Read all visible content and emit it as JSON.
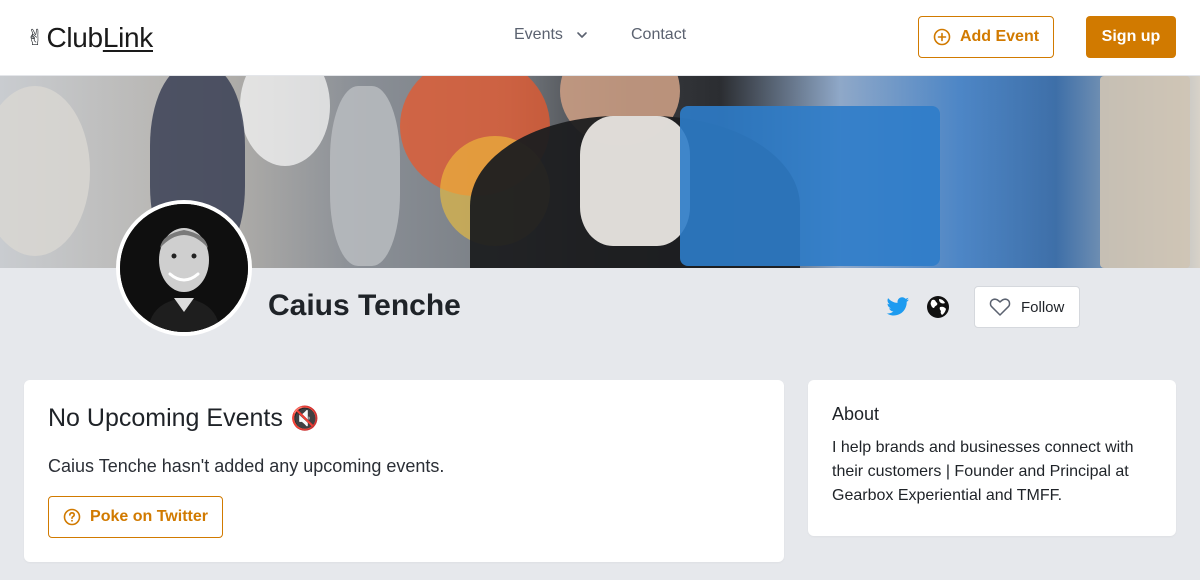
{
  "header": {
    "logo_club": "Club",
    "logo_link": "Link",
    "logo_hand": "✌",
    "nav": {
      "events": "Events",
      "contact": "Contact"
    },
    "add_event": "Add Event",
    "sign_up": "Sign up"
  },
  "profile": {
    "name": "Caius Tenche"
  },
  "events_card": {
    "title": "No Upcoming Events",
    "title_emoji": "🔇",
    "description": "Caius Tenche hasn't added any upcoming events.",
    "poke_label": "Poke on Twitter"
  },
  "about_card": {
    "title": "About",
    "text": "I help brands and businesses connect with their customers | Founder and Principal at Gearbox Experiential and TMFF."
  },
  "follow_label": "Follow",
  "colors": {
    "accent": "#d17a00",
    "twitter": "#1d9bf0",
    "background": "#e6e8ec"
  },
  "icons": {
    "add": "plus-circle-icon",
    "chevron": "chevron-down-icon",
    "twitter": "twitter-icon",
    "globe": "globe-icon",
    "follow": "heart-icon",
    "poke": "question-circle-icon"
  }
}
